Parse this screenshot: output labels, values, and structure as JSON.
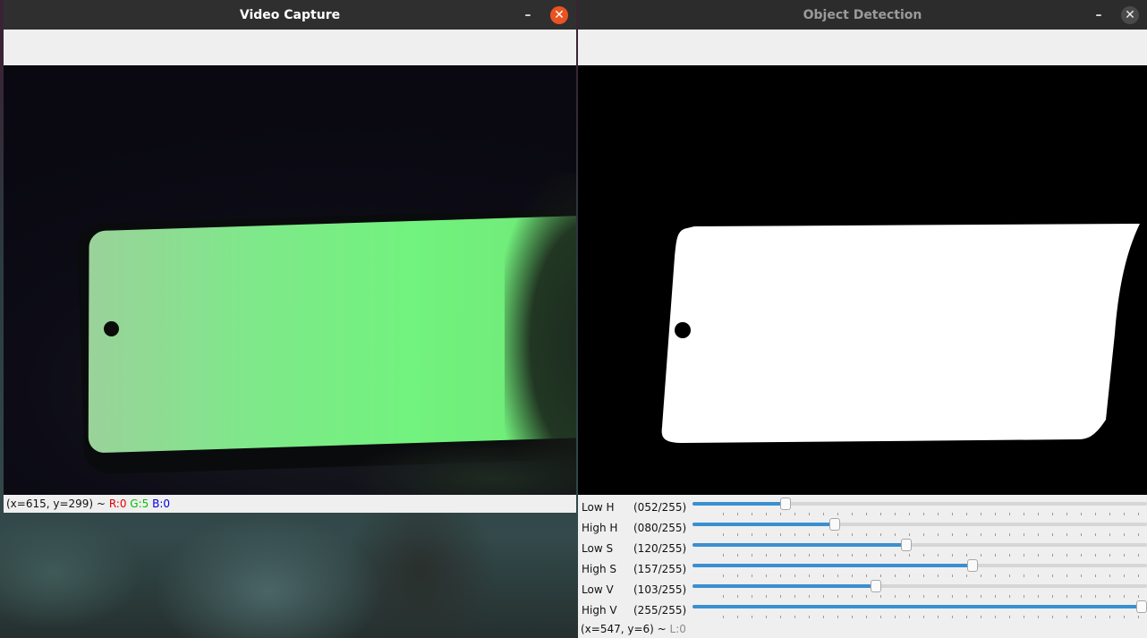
{
  "video_window": {
    "title": "Video Capture",
    "status": {
      "coords": "(x=615, y=299) ~",
      "r": "R:0",
      "g": "G:5",
      "b": "B:0"
    }
  },
  "detection_window": {
    "title": "Object Detection",
    "status": {
      "coords": "(x=547, y=6) ~",
      "l": "L:0"
    },
    "trackbars": [
      {
        "label": "Low H",
        "value_text": "(052/255)",
        "value": 52,
        "max": 255
      },
      {
        "label": "High H",
        "value_text": "(080/255)",
        "value": 80,
        "max": 255
      },
      {
        "label": "Low S",
        "value_text": "(120/255)",
        "value": 120,
        "max": 255
      },
      {
        "label": "High S",
        "value_text": "(157/255)",
        "value": 157,
        "max": 255
      },
      {
        "label": "Low V",
        "value_text": "(103/255)",
        "value": 103,
        "max": 255
      },
      {
        "label": "High V",
        "value_text": "(255/255)",
        "value": 255,
        "max": 255
      }
    ]
  },
  "icons": {
    "minimize": "minimize-icon",
    "close": "close-icon"
  },
  "colors": {
    "close_active": "#e95420",
    "slider_fill": "#3a8fd0",
    "status_r": "#e00000",
    "status_g": "#00c000",
    "status_b": "#0000e0"
  }
}
